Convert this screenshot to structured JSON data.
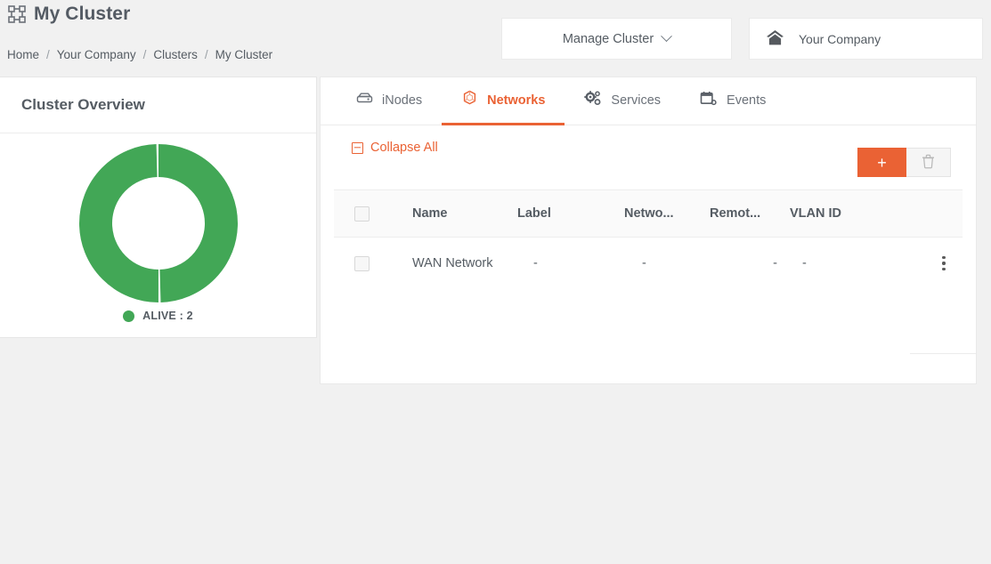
{
  "header": {
    "title": "My Cluster",
    "title_icon": "cluster-topology-icon",
    "breadcrumb": [
      "Home",
      "Your Company",
      "Clusters",
      "My Cluster"
    ],
    "breadcrumb_separator": "/",
    "manage_cluster_label": "Manage Cluster",
    "manage_cluster_icon": "chevron-down-icon",
    "company_label": "Your Company",
    "company_icon": "home-icon"
  },
  "overview": {
    "title": "Cluster Overview"
  },
  "chart_data": {
    "type": "pie",
    "variant": "donut",
    "title": "Cluster Overview",
    "categories": [
      "ALIVE",
      "ALIVE"
    ],
    "values": [
      1,
      1
    ],
    "colors": [
      "#42a756",
      "#42a756"
    ],
    "legend": [
      {
        "label": "ALIVE : 2",
        "color": "#42a756",
        "value": 2
      }
    ],
    "legend_position": "bottom",
    "total": 2,
    "inner_radius_ratio": 0.58,
    "grid": false
  },
  "tabs": [
    {
      "label": "iNodes",
      "icon": "server-icon",
      "active": false
    },
    {
      "label": "Networks",
      "icon": "hexagon-network-icon",
      "active": true
    },
    {
      "label": "Services",
      "icon": "cogs-icon",
      "active": false
    },
    {
      "label": "Events",
      "icon": "calendar-gear-icon",
      "active": false
    }
  ],
  "toolbar": {
    "collapse_all_label": "Collapse All",
    "collapse_all_icon": "minus-square-icon",
    "add_label": "+",
    "add_icon": "plus-icon",
    "delete_icon": "trash-icon"
  },
  "table": {
    "columns": [
      "Name",
      "Label",
      "Netwo...",
      "Remot...",
      "VLAN ID"
    ],
    "rows": [
      {
        "name": "WAN Network",
        "label": "-",
        "network": "-",
        "remote": "-",
        "vlan_id": "-",
        "menu_icon": "kebab-menu-icon"
      }
    ]
  },
  "colors": {
    "accent": "#ea6234",
    "status_alive": "#42a756",
    "page_background": "#f1f1f1",
    "panel_background": "#ffffff",
    "text": "#555c63"
  }
}
